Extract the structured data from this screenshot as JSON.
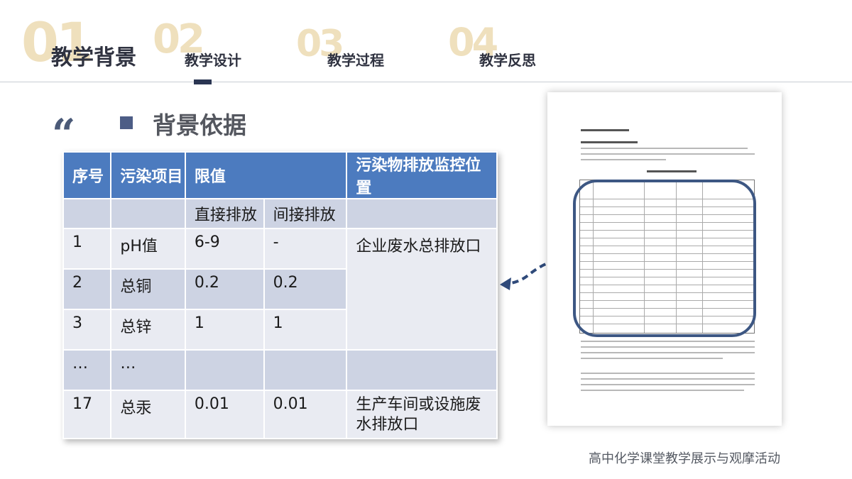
{
  "nav": {
    "items": [
      {
        "num": "01",
        "label": "教学背景",
        "active": true
      },
      {
        "num": "02",
        "label": "教学设计",
        "active": false
      },
      {
        "num": "03",
        "label": "教学过程",
        "active": false
      },
      {
        "num": "04",
        "label": "教学反思",
        "active": false
      }
    ]
  },
  "section": {
    "quote_mark": "“",
    "heading": "背景依据"
  },
  "table": {
    "headers": [
      "序号",
      "污染项目",
      "限值",
      "污染物排放监控位置"
    ],
    "subheaders": [
      "直接排放",
      "间接排放"
    ],
    "rows": [
      {
        "no": "1",
        "item": "pH值",
        "direct": "6-9",
        "indirect": "-"
      },
      {
        "no": "2",
        "item": "总铜",
        "direct": "0.2",
        "indirect": "0.2"
      },
      {
        "no": "3",
        "item": "总锌",
        "direct": "1",
        "indirect": "1"
      },
      {
        "no": "…",
        "item": "…",
        "direct": "",
        "indirect": ""
      },
      {
        "no": "17",
        "item": "总汞",
        "direct": "0.01",
        "indirect": "0.01"
      }
    ],
    "location_1": "企业废水总排放口",
    "location_2": "生产车间或设施废水排放口"
  },
  "footer": {
    "text": "高中化学课堂教学展示与观摩活动"
  },
  "colors": {
    "header_blue": "#4c7bbf",
    "row_dark": "#cdd3e3",
    "row_light": "#e9ebf2",
    "accent_navy": "#3d5783",
    "number_gold": "#efe0bd"
  }
}
